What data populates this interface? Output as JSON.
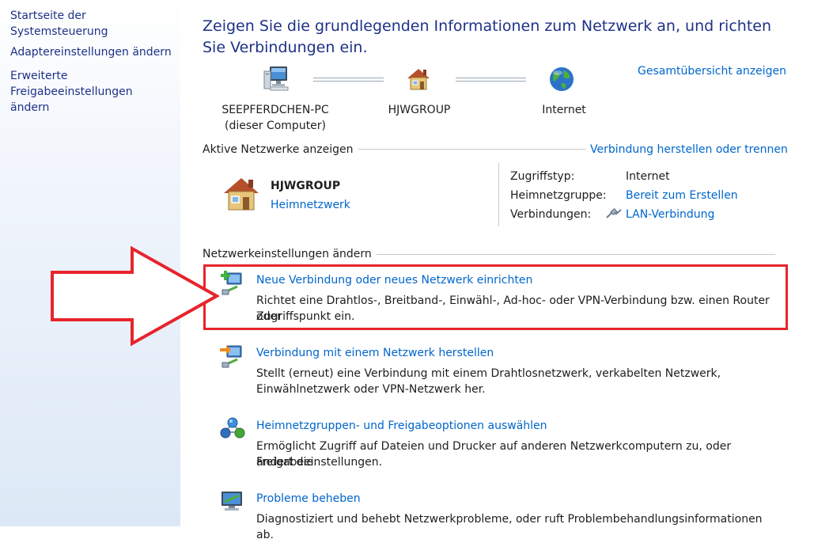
{
  "sidebar": {
    "items": [
      {
        "label": "Startseite der Systemsteuerung"
      },
      {
        "label": "Adaptereinstellungen ändern"
      },
      {
        "label": "Erweiterte Freigabeeinstellungen ändern"
      }
    ]
  },
  "main": {
    "title": "Zeigen Sie die grundlegenden Informationen zum Netzwerk an, und richten Sie Verbindungen ein.",
    "overview_link": "Gesamtübersicht anzeigen",
    "map": {
      "computer_name": "SEEPFERDCHEN-PC",
      "computer_note": "(dieser Computer)",
      "group_name": "HJWGROUP",
      "internet_label": "Internet"
    },
    "active_networks": {
      "section_label": "Aktive Netzwerke anzeigen",
      "connect_link": "Verbindung herstellen oder trennen",
      "network_name": "HJWGROUP",
      "network_type": "Heimnetzwerk",
      "access_type_label": "Zugriffstyp:",
      "access_type_value": "Internet",
      "homegroup_label": "Heimnetzgruppe:",
      "homegroup_value": "Bereit zum Erstellen",
      "connections_label": "Verbindungen:",
      "connections_value": "LAN-Verbindung"
    },
    "settings": {
      "section_label": "Netzwerkeinstellungen ändern",
      "tasks": [
        {
          "title": "Neue Verbindung oder neues Netzwerk einrichten",
          "desc_line1": "Richtet eine Drahtlos-, Breitband-, Einwähl-, Ad-hoc- oder VPN-Verbindung bzw. einen Router oder",
          "desc_line2": "Zugriffspunkt ein."
        },
        {
          "title": "Verbindung mit einem Netzwerk herstellen",
          "desc_line1": "Stellt (erneut) eine Verbindung mit einem Drahtlosnetzwerk, verkabelten Netzwerk,",
          "desc_line2": "Einwählnetzwerk oder VPN-Netzwerk her."
        },
        {
          "title": "Heimnetzgruppen- und Freigabeoptionen auswählen",
          "desc_line1": "Ermöglicht Zugriff auf Dateien und Drucker auf anderen Netzwerkcomputern zu, oder ändert die",
          "desc_line2": "Freigabeeinstellungen."
        },
        {
          "title": "Probleme beheben",
          "desc_line1": "Diagnostiziert und behebt Netzwerkprobleme, oder ruft Problembehandlungsinformationen ab.",
          "desc_line2": ""
        }
      ]
    }
  },
  "colors": {
    "link": "#0066cc",
    "title": "#1e3287",
    "highlight": "#e8242c"
  },
  "icons": {
    "computer": "computer-icon",
    "house": "house-icon",
    "globe": "globe-icon",
    "new_connection": "network-add-icon",
    "connect": "network-connect-icon",
    "homegroup": "homegroup-icon",
    "troubleshoot": "troubleshoot-icon",
    "lan": "lan-cable-icon",
    "arrow": "red-arrow-icon"
  }
}
